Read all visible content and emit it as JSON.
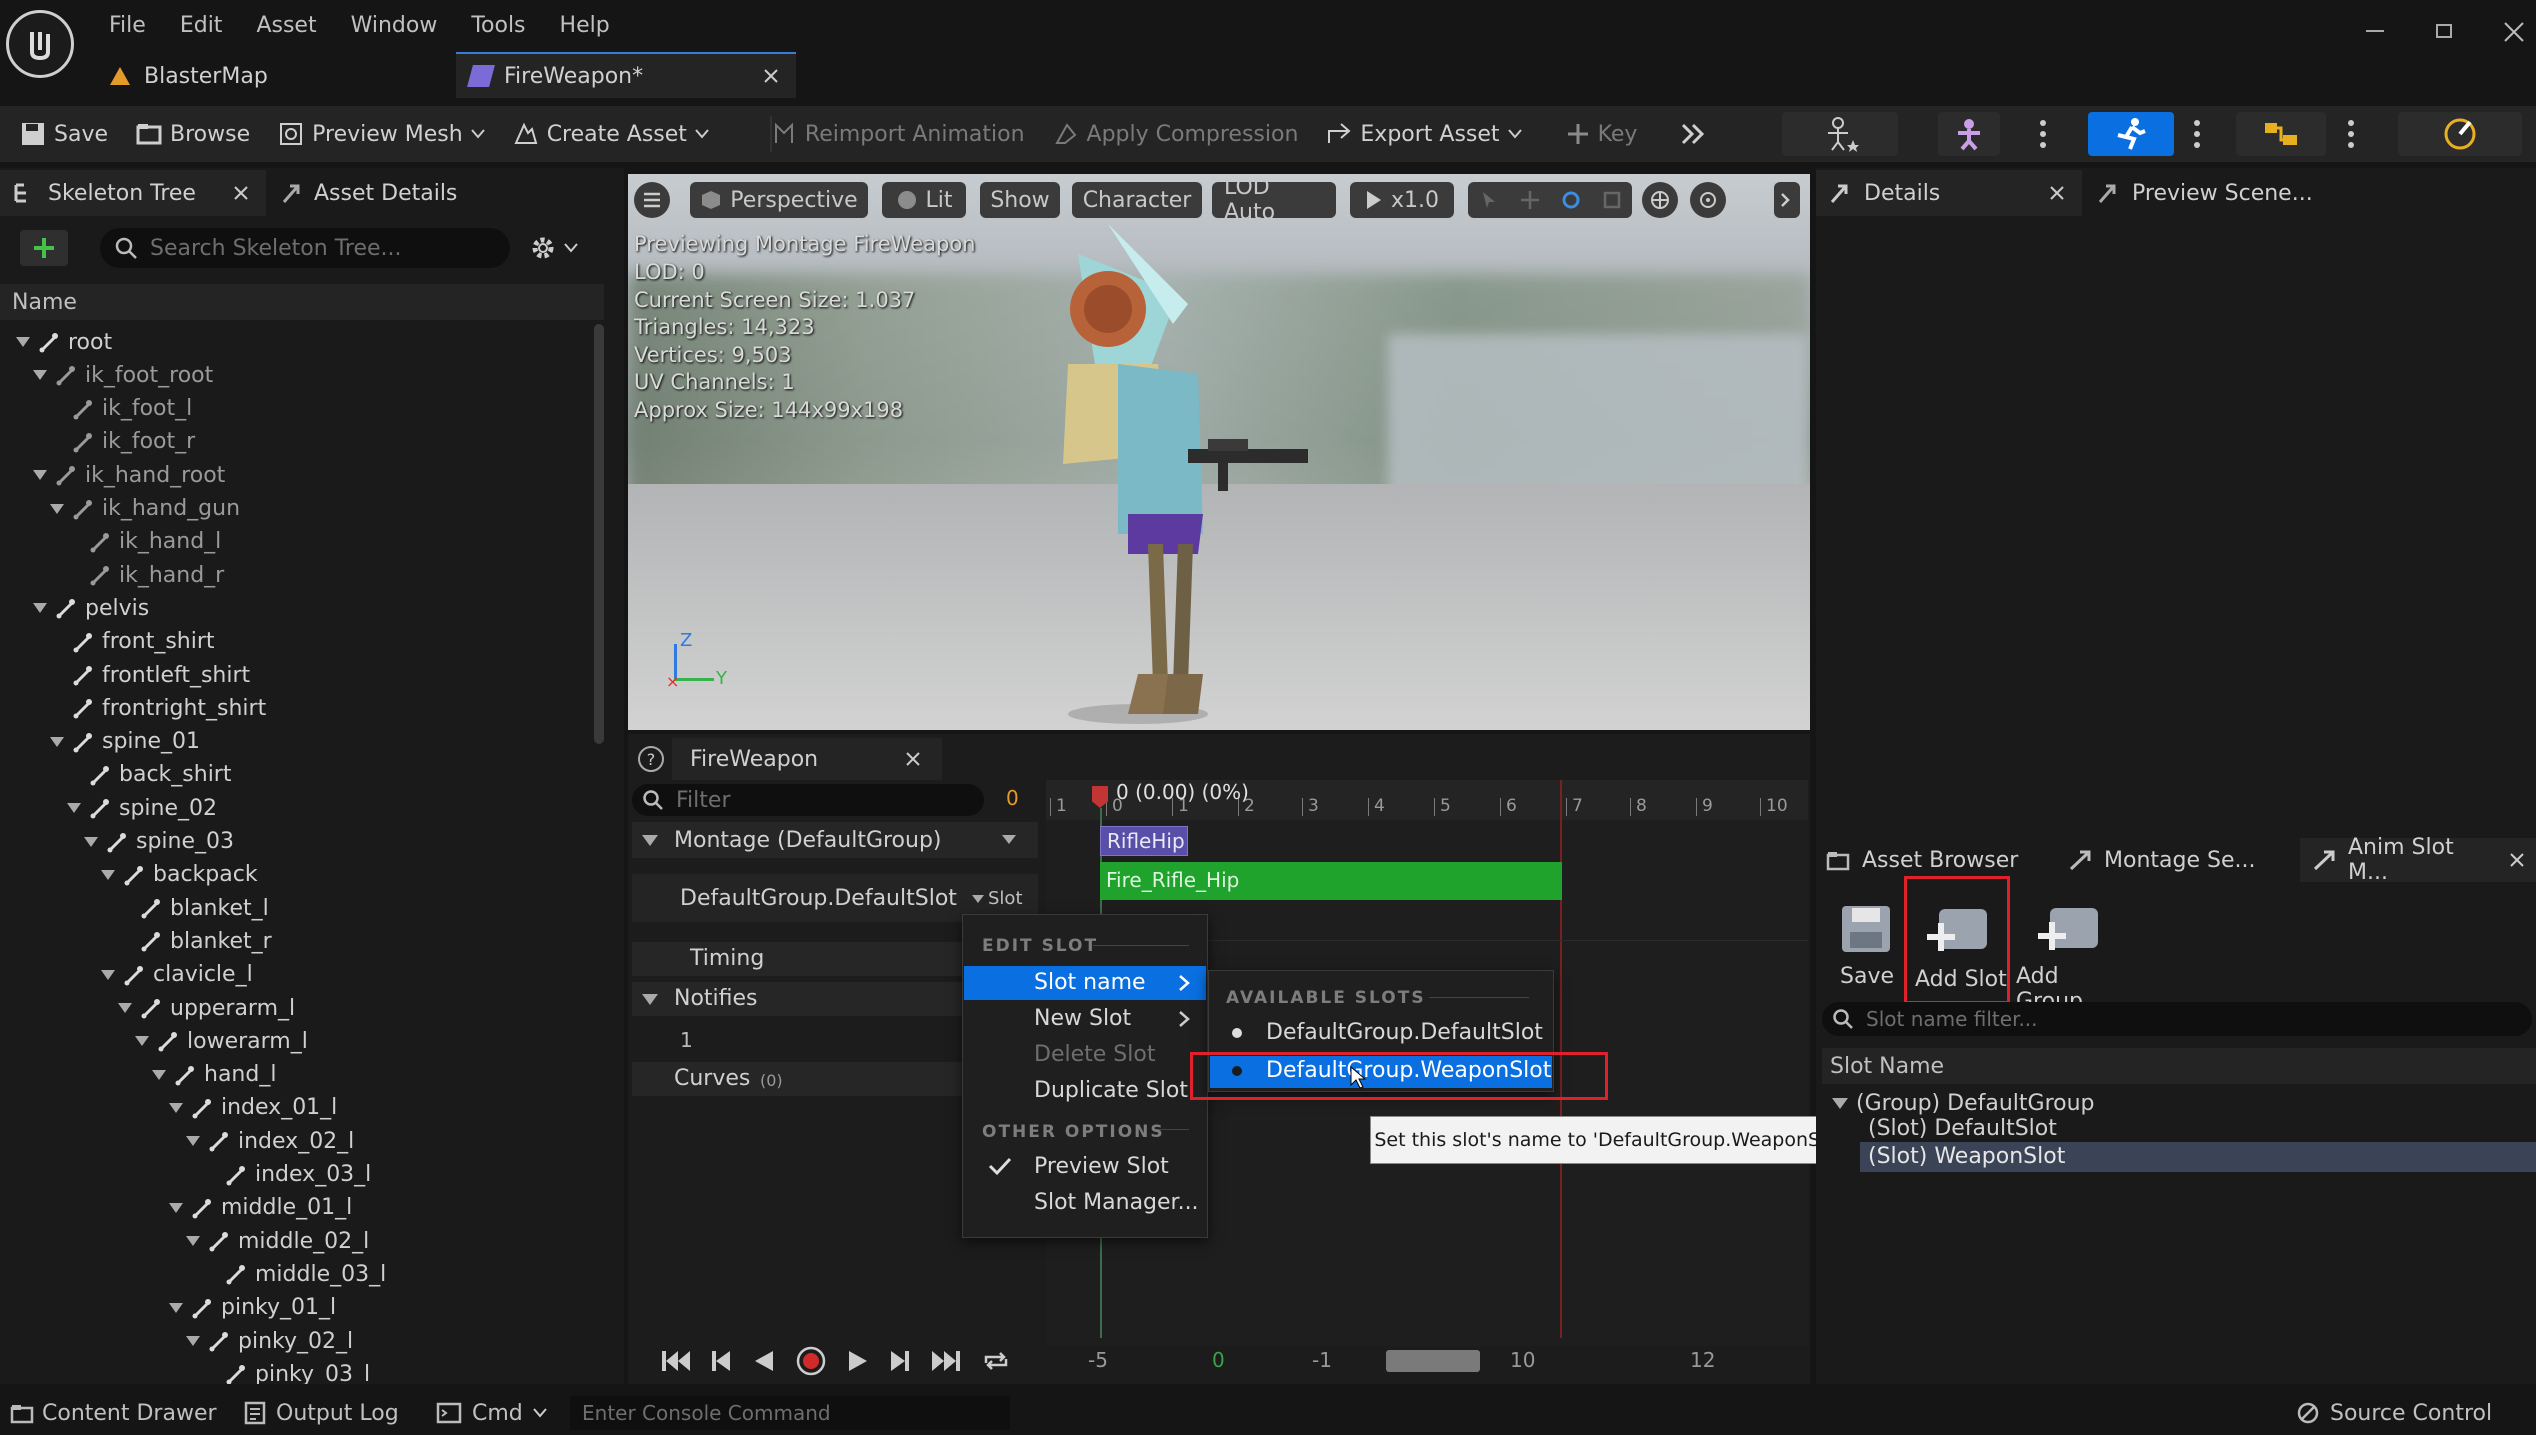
{
  "menu": {
    "items": [
      "File",
      "Edit",
      "Asset",
      "Window",
      "Tools",
      "Help"
    ]
  },
  "doc_tabs": [
    {
      "label": "BlasterMap"
    },
    {
      "label": "FireWeapon*"
    }
  ],
  "toolbar": {
    "save": "Save",
    "browse": "Browse",
    "preview_mesh": "Preview Mesh",
    "create_asset": "Create Asset",
    "reimport": "Reimport Animation",
    "apply_compression": "Apply Compression",
    "export_asset": "Export Asset",
    "key": "Key"
  },
  "skeleton_panel": {
    "tab1": "Skeleton Tree",
    "tab2": "Asset Details",
    "search_placeholder": "Search Skeleton Tree...",
    "column": "Name",
    "bones": [
      "root",
      "ik_foot_root",
      "ik_foot_l",
      "ik_foot_r",
      "ik_hand_root",
      "ik_hand_gun",
      "ik_hand_l",
      "ik_hand_r",
      "pelvis",
      "front_shirt",
      "frontleft_shirt",
      "frontright_shirt",
      "spine_01",
      "back_shirt",
      "spine_02",
      "spine_03",
      "backpack",
      "blanket_l",
      "blanket_r",
      "clavicle_l",
      "upperarm_l",
      "lowerarm_l",
      "hand_l",
      "index_01_l",
      "index_02_l",
      "index_03_l",
      "middle_01_l",
      "middle_02_l",
      "middle_03_l",
      "pinky_01_l",
      "pinky_02_l",
      "pinky_03_l"
    ]
  },
  "viewport": {
    "buttons": {
      "perspective": "Perspective",
      "lit": "Lit",
      "show": "Show",
      "character": "Character",
      "lod": "LOD Auto",
      "speed": "x1.0"
    },
    "overlay": [
      "Previewing Montage FireWeapon",
      "LOD: 0",
      "Current Screen Size: 1.037",
      "Triangles: 14,323",
      "Vertices: 9,503",
      "UV Channels: 1",
      "Approx Size: 144x99x198"
    ],
    "axis_z": "Z",
    "axis_y": "Y"
  },
  "montage": {
    "tab": "FireWeapon",
    "filter_placeholder": "Filter",
    "filter_count": "0",
    "montage_row": "Montage (DefaultGroup)",
    "slot_row": "DefaultGroup.DefaultSlot",
    "slot_btn": "Slot",
    "timing": "Timing",
    "notifies": "Notifies",
    "notify_index": "1",
    "curves": "Curves",
    "curves_count": "(0)",
    "timeline_head": "0 (0.00) (0%)",
    "ticks": [
      "1",
      "0",
      "1",
      "2",
      "3",
      "4",
      "5",
      "6",
      "7",
      "8",
      "9",
      "10"
    ],
    "section": "RifleHip",
    "anim": "Fire_Rifle_Hip",
    "bottom_labels": [
      "-5",
      "0",
      "-1",
      "10",
      "12"
    ]
  },
  "context_menu": {
    "edit_header": "EDIT SLOT",
    "slot_name": "Slot name",
    "new_slot": "New Slot",
    "delete_slot": "Delete Slot",
    "duplicate_slot": "Duplicate Slot",
    "other_header": "OTHER OPTIONS",
    "preview_slot": "Preview Slot",
    "slot_manager": "Slot Manager..."
  },
  "submenu": {
    "header": "AVAILABLE SLOTS",
    "items": [
      "DefaultGroup.DefaultSlot",
      "DefaultGroup.WeaponSlot"
    ]
  },
  "tooltip": "Set this slot's name to 'DefaultGroup.WeaponSlot'",
  "details_panel": {
    "tab1": "Details",
    "tab2": "Preview Scene..."
  },
  "slot_manager": {
    "tabs": [
      "Asset Browser",
      "Montage Se...",
      "Anim Slot M..."
    ],
    "save": "Save",
    "add_slot": "Add Slot",
    "add_group": "Add Group",
    "filter_placeholder": "Slot name filter...",
    "column": "Slot Name",
    "group": "(Group) DefaultGroup",
    "slots": [
      "(Slot) DefaultSlot",
      "(Slot) WeaponSlot"
    ]
  },
  "status_bar": {
    "content_drawer": "Content Drawer",
    "output_log": "Output Log",
    "cmd": "Cmd",
    "console_placeholder": "Enter Console Command",
    "source_control": "Source Control"
  },
  "colors": {
    "accent_blue": "#0a6fe0",
    "highlight_red": "#e0202a",
    "anim_green": "#1fa32c",
    "section_purple": "#6a5ab8"
  }
}
